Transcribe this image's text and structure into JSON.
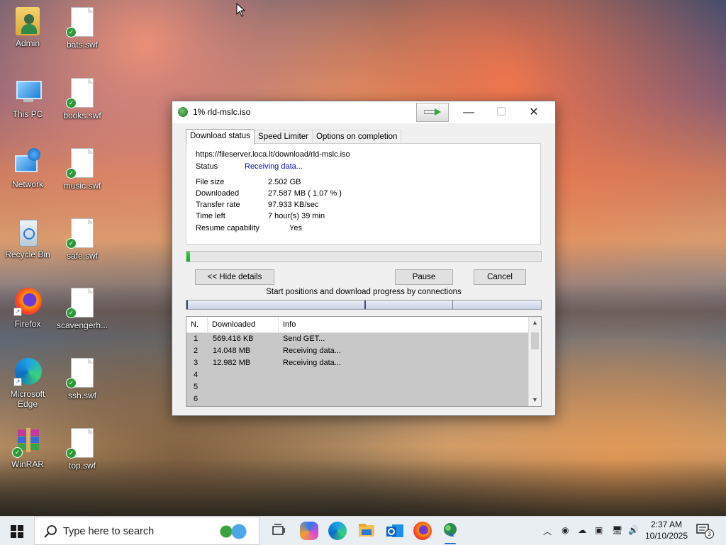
{
  "desktop": {
    "icons": [
      {
        "label": "Admin"
      },
      {
        "label": "bats.swf"
      },
      {
        "label": "This PC"
      },
      {
        "label": "books.swf"
      },
      {
        "label": "Network"
      },
      {
        "label": "music.swf"
      },
      {
        "label": "Recycle Bin"
      },
      {
        "label": "safe.swf"
      },
      {
        "label": "Firefox"
      },
      {
        "label": "scavengerh..."
      },
      {
        "label": "Microsoft Edge"
      },
      {
        "label": "ssh.swf"
      },
      {
        "label": "WinRAR"
      },
      {
        "label": "top.swf"
      }
    ]
  },
  "window": {
    "title": "1% rld-mslc.iso",
    "tabs": [
      "Download status",
      "Speed Limiter",
      "Options on completion"
    ],
    "url": "https://fileserver.loca.lt/download/rld-mslc.iso",
    "status_label": "Status",
    "status_value": "Receiving data...",
    "file_size_label": "File size",
    "file_size_value": "2.502  GB",
    "downloaded_label": "Downloaded",
    "downloaded_value": "27.587  MB  ( 1.07 % )",
    "transfer_rate_label": "Transfer rate",
    "transfer_rate_value": "97.933  KB/sec",
    "time_left_label": "Time left",
    "time_left_value": "7 hour(s) 39 min",
    "resume_label": "Resume capability",
    "resume_value": "Yes",
    "progress_fraction": 0.0107,
    "buttons": {
      "hide_details": "<< Hide details",
      "pause": "Pause",
      "cancel": "Cancel"
    },
    "connections_caption": "Start positions and download progress by connections",
    "table": {
      "headers": [
        "N.",
        "Downloaded",
        "Info"
      ],
      "rows": [
        [
          "1",
          "569.416  KB",
          "Send GET..."
        ],
        [
          "2",
          "14.048  MB",
          "Receiving data..."
        ],
        [
          "3",
          "12.982  MB",
          "Receiving data..."
        ],
        [
          "4",
          "",
          ""
        ],
        [
          "5",
          "",
          ""
        ],
        [
          "6",
          "",
          ""
        ]
      ]
    }
  },
  "taskbar": {
    "search_placeholder": "Type here to search",
    "time": "2:37 AM",
    "date": "10/10/2025",
    "notification_count": "3"
  }
}
